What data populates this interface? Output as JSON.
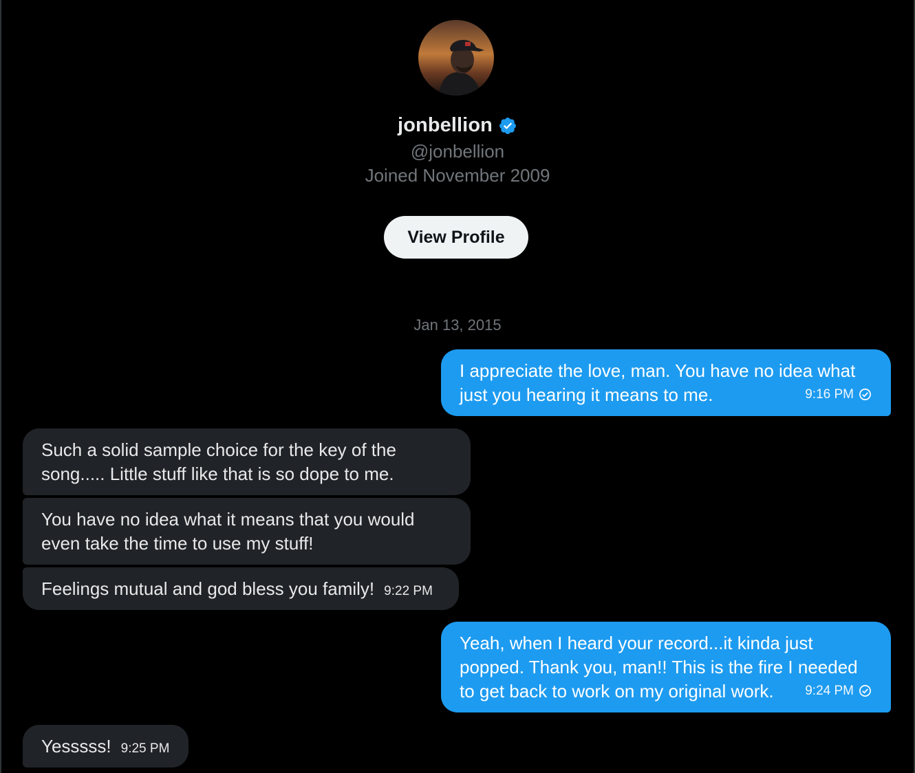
{
  "profile": {
    "display_name": "jonbellion",
    "handle": "@jonbellion",
    "joined": "Joined November 2009",
    "view_profile_label": "View Profile"
  },
  "conversation": {
    "date": "Jan 13, 2015",
    "messages": [
      {
        "direction": "sent",
        "lines": [
          "I appreciate the love, man. You have no idea what",
          "just you hearing it means to me."
        ],
        "time": "9:16 PM",
        "read": true
      },
      {
        "direction": "received",
        "lines": [
          "Such a solid sample choice for the key of the",
          "song..... Little stuff like that is so dope to me."
        ]
      },
      {
        "direction": "received",
        "lines": [
          "You have no idea what it means that you would",
          "even take the time to use my stuff!"
        ]
      },
      {
        "direction": "received",
        "lines": [
          "Feelings mutual and god bless you family!"
        ],
        "time": "9:22 PM"
      },
      {
        "direction": "sent",
        "lines": [
          "Yeah, when I heard your record...it kinda just",
          "popped. Thank you, man!! This is the fire I needed",
          "to get back to work on my original work."
        ],
        "time": "9:24 PM",
        "read": true
      },
      {
        "direction": "received",
        "lines": [
          "Yesssss!"
        ],
        "time": "9:25 PM"
      }
    ]
  },
  "colors": {
    "background": "#000000",
    "sent_bubble": "#1d9bf0",
    "received_bubble": "#202327",
    "verified_badge": "#1d9bf0",
    "muted_text": "#71767b"
  },
  "icons": {
    "verified": "verified-badge-icon",
    "read_receipt": "check-circle-icon"
  }
}
